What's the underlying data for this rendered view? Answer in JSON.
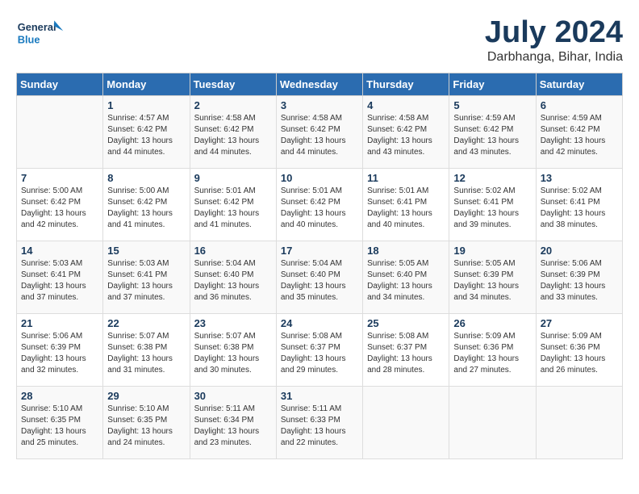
{
  "header": {
    "logo_line1": "General",
    "logo_line2": "Blue",
    "month_year": "July 2024",
    "location": "Darbhanga, Bihar, India"
  },
  "weekdays": [
    "Sunday",
    "Monday",
    "Tuesday",
    "Wednesday",
    "Thursday",
    "Friday",
    "Saturday"
  ],
  "weeks": [
    [
      {
        "day": "",
        "info": ""
      },
      {
        "day": "1",
        "info": "Sunrise: 4:57 AM\nSunset: 6:42 PM\nDaylight: 13 hours\nand 44 minutes."
      },
      {
        "day": "2",
        "info": "Sunrise: 4:58 AM\nSunset: 6:42 PM\nDaylight: 13 hours\nand 44 minutes."
      },
      {
        "day": "3",
        "info": "Sunrise: 4:58 AM\nSunset: 6:42 PM\nDaylight: 13 hours\nand 44 minutes."
      },
      {
        "day": "4",
        "info": "Sunrise: 4:58 AM\nSunset: 6:42 PM\nDaylight: 13 hours\nand 43 minutes."
      },
      {
        "day": "5",
        "info": "Sunrise: 4:59 AM\nSunset: 6:42 PM\nDaylight: 13 hours\nand 43 minutes."
      },
      {
        "day": "6",
        "info": "Sunrise: 4:59 AM\nSunset: 6:42 PM\nDaylight: 13 hours\nand 42 minutes."
      }
    ],
    [
      {
        "day": "7",
        "info": "Sunrise: 5:00 AM\nSunset: 6:42 PM\nDaylight: 13 hours\nand 42 minutes."
      },
      {
        "day": "8",
        "info": "Sunrise: 5:00 AM\nSunset: 6:42 PM\nDaylight: 13 hours\nand 41 minutes."
      },
      {
        "day": "9",
        "info": "Sunrise: 5:01 AM\nSunset: 6:42 PM\nDaylight: 13 hours\nand 41 minutes."
      },
      {
        "day": "10",
        "info": "Sunrise: 5:01 AM\nSunset: 6:42 PM\nDaylight: 13 hours\nand 40 minutes."
      },
      {
        "day": "11",
        "info": "Sunrise: 5:01 AM\nSunset: 6:41 PM\nDaylight: 13 hours\nand 40 minutes."
      },
      {
        "day": "12",
        "info": "Sunrise: 5:02 AM\nSunset: 6:41 PM\nDaylight: 13 hours\nand 39 minutes."
      },
      {
        "day": "13",
        "info": "Sunrise: 5:02 AM\nSunset: 6:41 PM\nDaylight: 13 hours\nand 38 minutes."
      }
    ],
    [
      {
        "day": "14",
        "info": "Sunrise: 5:03 AM\nSunset: 6:41 PM\nDaylight: 13 hours\nand 37 minutes."
      },
      {
        "day": "15",
        "info": "Sunrise: 5:03 AM\nSunset: 6:41 PM\nDaylight: 13 hours\nand 37 minutes."
      },
      {
        "day": "16",
        "info": "Sunrise: 5:04 AM\nSunset: 6:40 PM\nDaylight: 13 hours\nand 36 minutes."
      },
      {
        "day": "17",
        "info": "Sunrise: 5:04 AM\nSunset: 6:40 PM\nDaylight: 13 hours\nand 35 minutes."
      },
      {
        "day": "18",
        "info": "Sunrise: 5:05 AM\nSunset: 6:40 PM\nDaylight: 13 hours\nand 34 minutes."
      },
      {
        "day": "19",
        "info": "Sunrise: 5:05 AM\nSunset: 6:39 PM\nDaylight: 13 hours\nand 34 minutes."
      },
      {
        "day": "20",
        "info": "Sunrise: 5:06 AM\nSunset: 6:39 PM\nDaylight: 13 hours\nand 33 minutes."
      }
    ],
    [
      {
        "day": "21",
        "info": "Sunrise: 5:06 AM\nSunset: 6:39 PM\nDaylight: 13 hours\nand 32 minutes."
      },
      {
        "day": "22",
        "info": "Sunrise: 5:07 AM\nSunset: 6:38 PM\nDaylight: 13 hours\nand 31 minutes."
      },
      {
        "day": "23",
        "info": "Sunrise: 5:07 AM\nSunset: 6:38 PM\nDaylight: 13 hours\nand 30 minutes."
      },
      {
        "day": "24",
        "info": "Sunrise: 5:08 AM\nSunset: 6:37 PM\nDaylight: 13 hours\nand 29 minutes."
      },
      {
        "day": "25",
        "info": "Sunrise: 5:08 AM\nSunset: 6:37 PM\nDaylight: 13 hours\nand 28 minutes."
      },
      {
        "day": "26",
        "info": "Sunrise: 5:09 AM\nSunset: 6:36 PM\nDaylight: 13 hours\nand 27 minutes."
      },
      {
        "day": "27",
        "info": "Sunrise: 5:09 AM\nSunset: 6:36 PM\nDaylight: 13 hours\nand 26 minutes."
      }
    ],
    [
      {
        "day": "28",
        "info": "Sunrise: 5:10 AM\nSunset: 6:35 PM\nDaylight: 13 hours\nand 25 minutes."
      },
      {
        "day": "29",
        "info": "Sunrise: 5:10 AM\nSunset: 6:35 PM\nDaylight: 13 hours\nand 24 minutes."
      },
      {
        "day": "30",
        "info": "Sunrise: 5:11 AM\nSunset: 6:34 PM\nDaylight: 13 hours\nand 23 minutes."
      },
      {
        "day": "31",
        "info": "Sunrise: 5:11 AM\nSunset: 6:33 PM\nDaylight: 13 hours\nand 22 minutes."
      },
      {
        "day": "",
        "info": ""
      },
      {
        "day": "",
        "info": ""
      },
      {
        "day": "",
        "info": ""
      }
    ]
  ]
}
